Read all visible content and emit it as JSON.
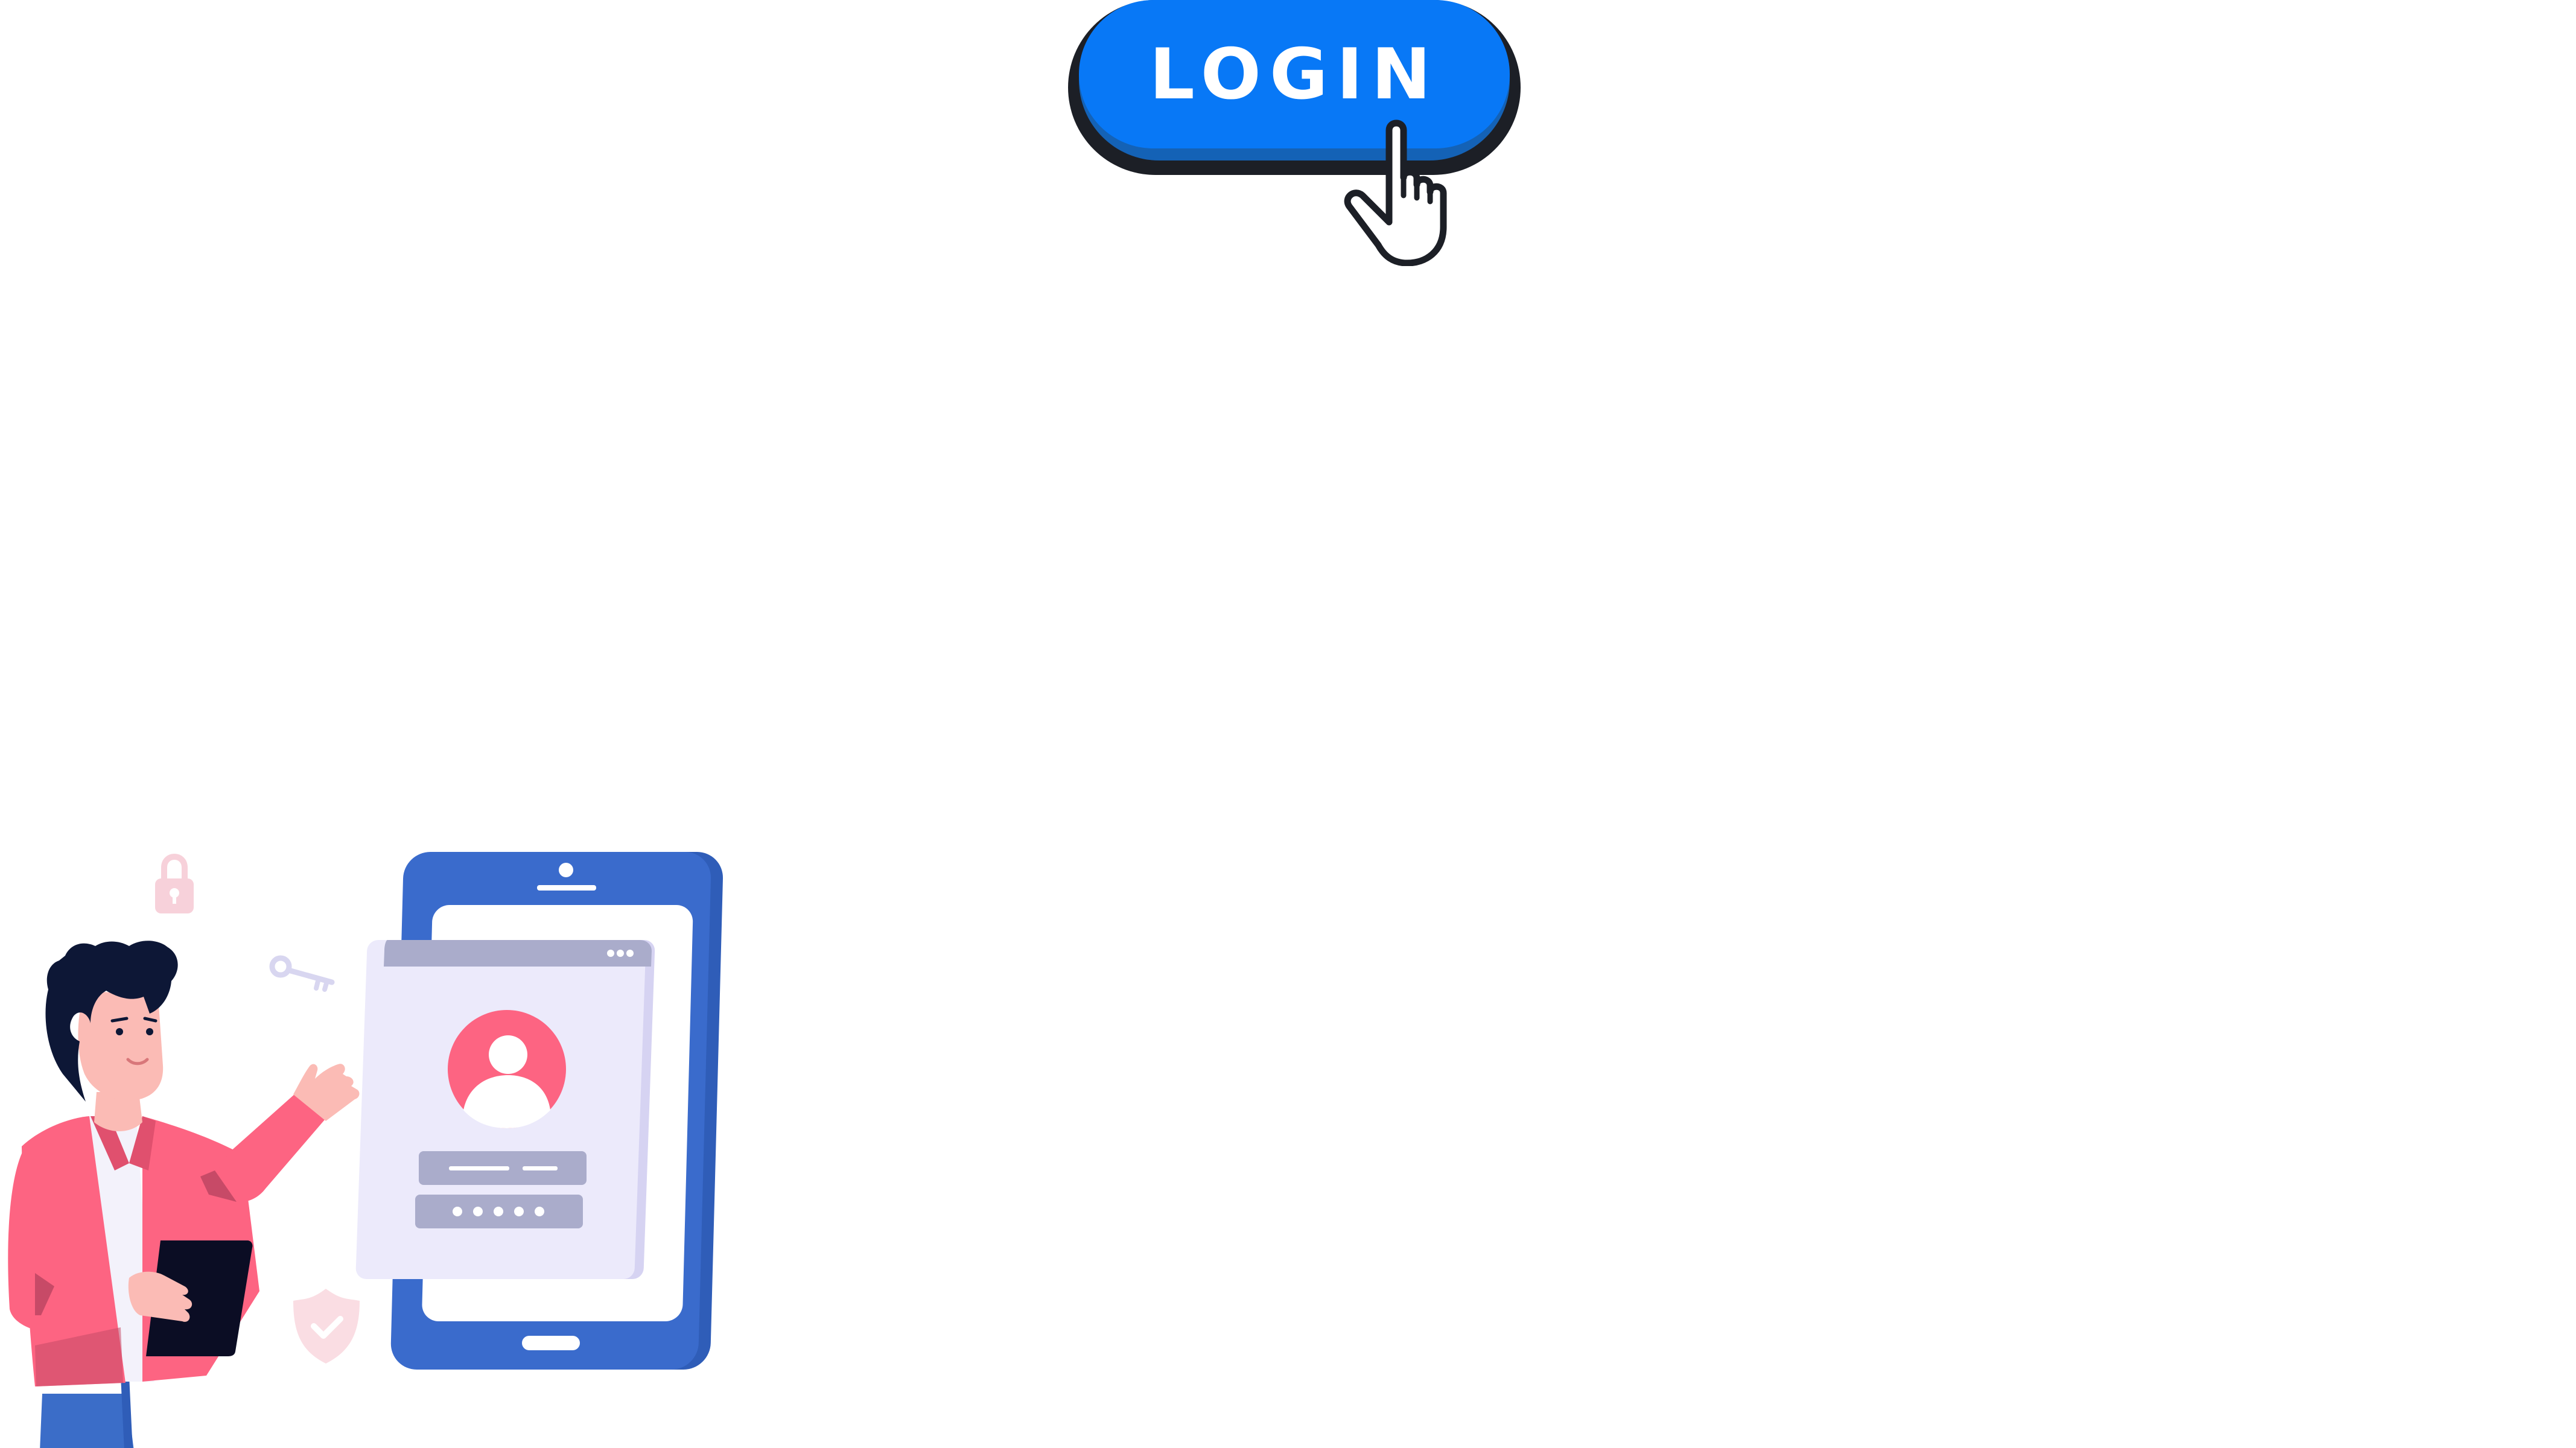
{
  "login_button": {
    "label": "LOGIN",
    "color": "#0878f6",
    "depth_color": "#1462b6",
    "outline_color": "#1c1f26"
  },
  "icons": {
    "cursor": "pointer-hand-icon",
    "lock": "padlock-icon",
    "key": "key-icon",
    "shield": "shield-check-icon",
    "avatar": "user-avatar-icon"
  },
  "illustration": {
    "phone_color": "#3a6bcc",
    "panel_color": "#eceafb",
    "titlebar_color": "#aaaccb",
    "avatar_color": "#fd6482",
    "person_jacket_color": "#fd6482",
    "person_pants_color": "#3b6dc8",
    "password_dots": "• • • • •"
  }
}
